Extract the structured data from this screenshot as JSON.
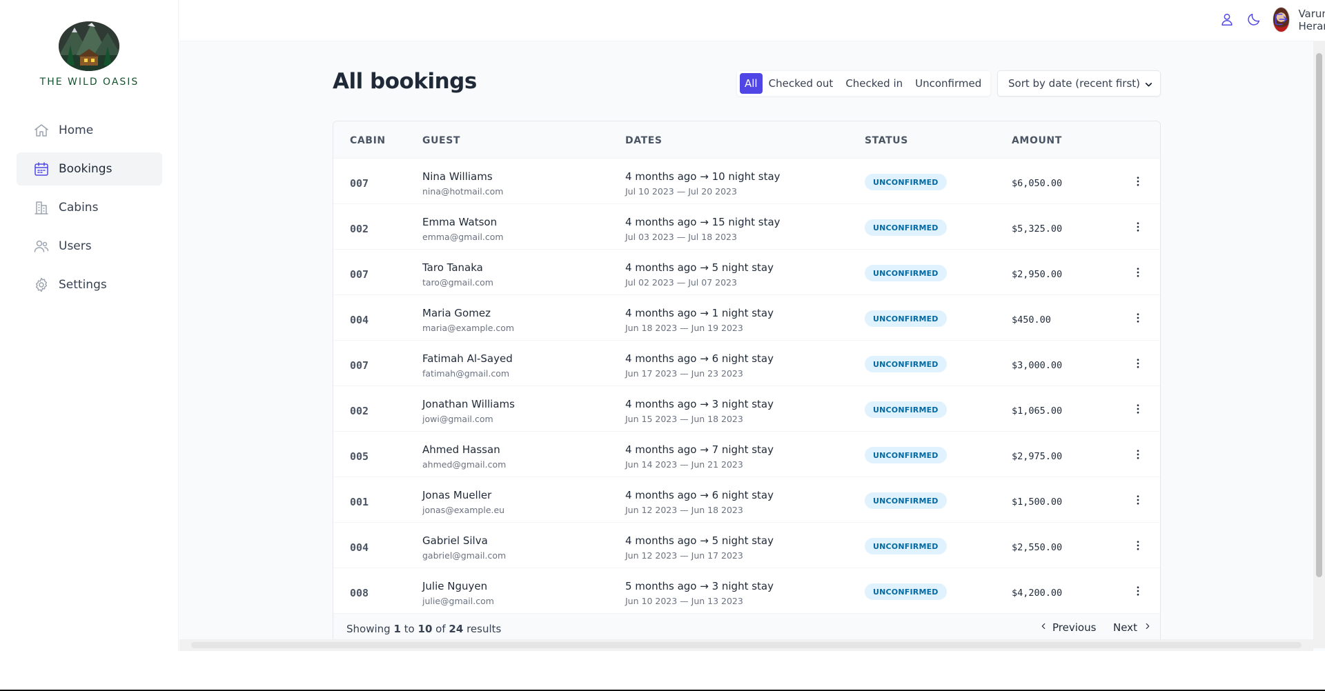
{
  "app": {
    "brand": "THE WILD OASIS",
    "user_name": "Varun Heranjal"
  },
  "sidebar": {
    "items": [
      {
        "label": "Home",
        "icon": "home-icon"
      },
      {
        "label": "Bookings",
        "icon": "calendar-icon",
        "active": true
      },
      {
        "label": "Cabins",
        "icon": "building-icon"
      },
      {
        "label": "Users",
        "icon": "users-icon"
      },
      {
        "label": "Settings",
        "icon": "gear-icon"
      }
    ]
  },
  "header": {
    "icons": [
      "user-icon",
      "moon-icon",
      "logout-icon"
    ]
  },
  "page": {
    "title": "All bookings",
    "filters": [
      "All",
      "Checked out",
      "Checked in",
      "Unconfirmed"
    ],
    "active_filter": "All",
    "sort_selected": "Sort by date (recent first)"
  },
  "table": {
    "headers": [
      "CABIN",
      "GUEST",
      "DATES",
      "STATUS",
      "AMOUNT"
    ],
    "rows": [
      {
        "cabin": "007",
        "guest": "Nina Williams",
        "email": "nina@hotmail.com",
        "when": "4 months ago → 10 night stay",
        "range": "Jul 10 2023 — Jul 20 2023",
        "status": "UNCONFIRMED",
        "amount": "$6,050.00"
      },
      {
        "cabin": "002",
        "guest": "Emma Watson",
        "email": "emma@gmail.com",
        "when": "4 months ago → 15 night stay",
        "range": "Jul 03 2023 — Jul 18 2023",
        "status": "UNCONFIRMED",
        "amount": "$5,325.00"
      },
      {
        "cabin": "007",
        "guest": "Taro Tanaka",
        "email": "taro@gmail.com",
        "when": "4 months ago → 5 night stay",
        "range": "Jul 02 2023 — Jul 07 2023",
        "status": "UNCONFIRMED",
        "amount": "$2,950.00"
      },
      {
        "cabin": "004",
        "guest": "Maria Gomez",
        "email": "maria@example.com",
        "when": "4 months ago → 1 night stay",
        "range": "Jun 18 2023 — Jun 19 2023",
        "status": "UNCONFIRMED",
        "amount": "$450.00"
      },
      {
        "cabin": "007",
        "guest": "Fatimah Al-Sayed",
        "email": "fatimah@gmail.com",
        "when": "4 months ago → 6 night stay",
        "range": "Jun 17 2023 — Jun 23 2023",
        "status": "UNCONFIRMED",
        "amount": "$3,000.00"
      },
      {
        "cabin": "002",
        "guest": "Jonathan Williams",
        "email": "jowi@gmail.com",
        "when": "4 months ago → 3 night stay",
        "range": "Jun 15 2023 — Jun 18 2023",
        "status": "UNCONFIRMED",
        "amount": "$1,065.00"
      },
      {
        "cabin": "005",
        "guest": "Ahmed Hassan",
        "email": "ahmed@gmail.com",
        "when": "4 months ago → 7 night stay",
        "range": "Jun 14 2023 — Jun 21 2023",
        "status": "UNCONFIRMED",
        "amount": "$2,975.00"
      },
      {
        "cabin": "001",
        "guest": "Jonas Mueller",
        "email": "jonas@example.eu",
        "when": "4 months ago → 6 night stay",
        "range": "Jun 12 2023 — Jun 18 2023",
        "status": "UNCONFIRMED",
        "amount": "$1,500.00"
      },
      {
        "cabin": "004",
        "guest": "Gabriel Silva",
        "email": "gabriel@gmail.com",
        "when": "4 months ago → 5 night stay",
        "range": "Jun 12 2023 — Jun 17 2023",
        "status": "UNCONFIRMED",
        "amount": "$2,550.00"
      },
      {
        "cabin": "008",
        "guest": "Julie Nguyen",
        "email": "julie@gmail.com",
        "when": "5 months ago → 3 night stay",
        "range": "Jun 10 2023 — Jun 13 2023",
        "status": "UNCONFIRMED",
        "amount": "$4,200.00"
      }
    ]
  },
  "pagination": {
    "showing_prefix": "Showing",
    "from": "1",
    "to_word": "to",
    "to": "10",
    "of_word": "of",
    "total": "24",
    "suffix": "results",
    "previous": "Previous",
    "next": "Next"
  },
  "colors": {
    "accent": "#4f46e5",
    "badge_bg": "#e0f2fe",
    "badge_text": "#0369a1",
    "brand_green": "#14532d"
  }
}
